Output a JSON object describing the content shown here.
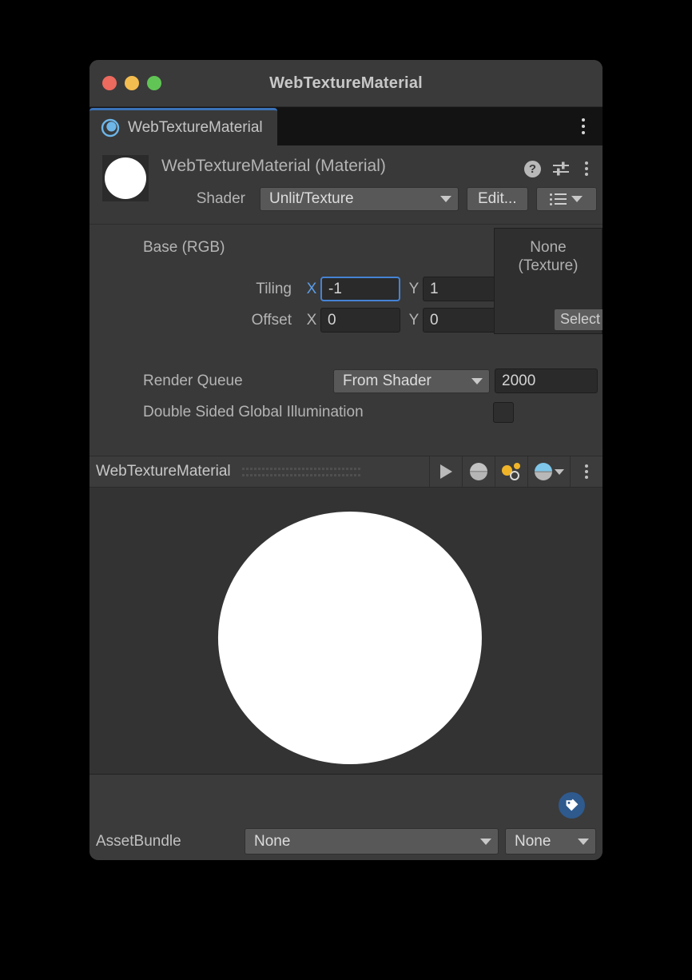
{
  "window": {
    "title": "WebTextureMaterial",
    "traffic_lights": [
      {
        "name": "close",
        "color": "#ec6a5e"
      },
      {
        "name": "minimize",
        "color": "#f4bd4f"
      },
      {
        "name": "zoom",
        "color": "#61c555"
      }
    ]
  },
  "tabbar": {
    "active_tab": "WebTextureMaterial",
    "tab_icon": "material-sphere-icon",
    "menu_icon": "kebab-menu-icon",
    "accent_color": "#3b72b8"
  },
  "inspector_header": {
    "title": "WebTextureMaterial (Material)",
    "thumbnail": "material-preview-thumbnail",
    "icons": [
      "help-icon",
      "preset-icon",
      "kebab-menu-icon"
    ],
    "help_glyph": "?",
    "shader": {
      "label": "Shader",
      "value": "Unlit/Texture",
      "edit_label": "Edit...",
      "list_button_icon": "shader-list-icon"
    }
  },
  "properties": {
    "base_label": "Base (RGB)",
    "tiling": {
      "label": "Tiling",
      "x_axis": "X",
      "x_value": "-1",
      "y_axis": "Y",
      "y_value": "1",
      "x_focused": true
    },
    "offset": {
      "label": "Offset",
      "x_axis": "X",
      "x_value": "0",
      "y_axis": "Y",
      "y_value": "0"
    },
    "texture_slot": {
      "line1": "None",
      "line2": "(Texture)",
      "select_label": "Select"
    },
    "render_queue": {
      "label": "Render Queue",
      "mode": "From Shader",
      "value": "2000"
    },
    "double_sided_gi": {
      "label": "Double Sided Global Illumination",
      "checked": false
    }
  },
  "preview": {
    "name": "WebTextureMaterial",
    "tools": [
      {
        "name": "play-button",
        "icon": "play-icon"
      },
      {
        "name": "preview-mesh-button",
        "icon": "sphere-icon"
      },
      {
        "name": "lighting-toggle-button",
        "icon": "lighting-icon"
      },
      {
        "name": "preview-environment-button",
        "icon": "environment-sphere-icon"
      },
      {
        "name": "preview-options-button",
        "icon": "kebab-menu-icon"
      }
    ],
    "sphere_color": "#ffffff",
    "background_color": "#333333"
  },
  "footer": {
    "tag_badge_icon": "asset-label-tag-icon",
    "tag_badge_color": "#2e5a8e",
    "assetbundle_label": "AssetBundle",
    "assetbundle_value": "None",
    "variant_value": "None"
  }
}
